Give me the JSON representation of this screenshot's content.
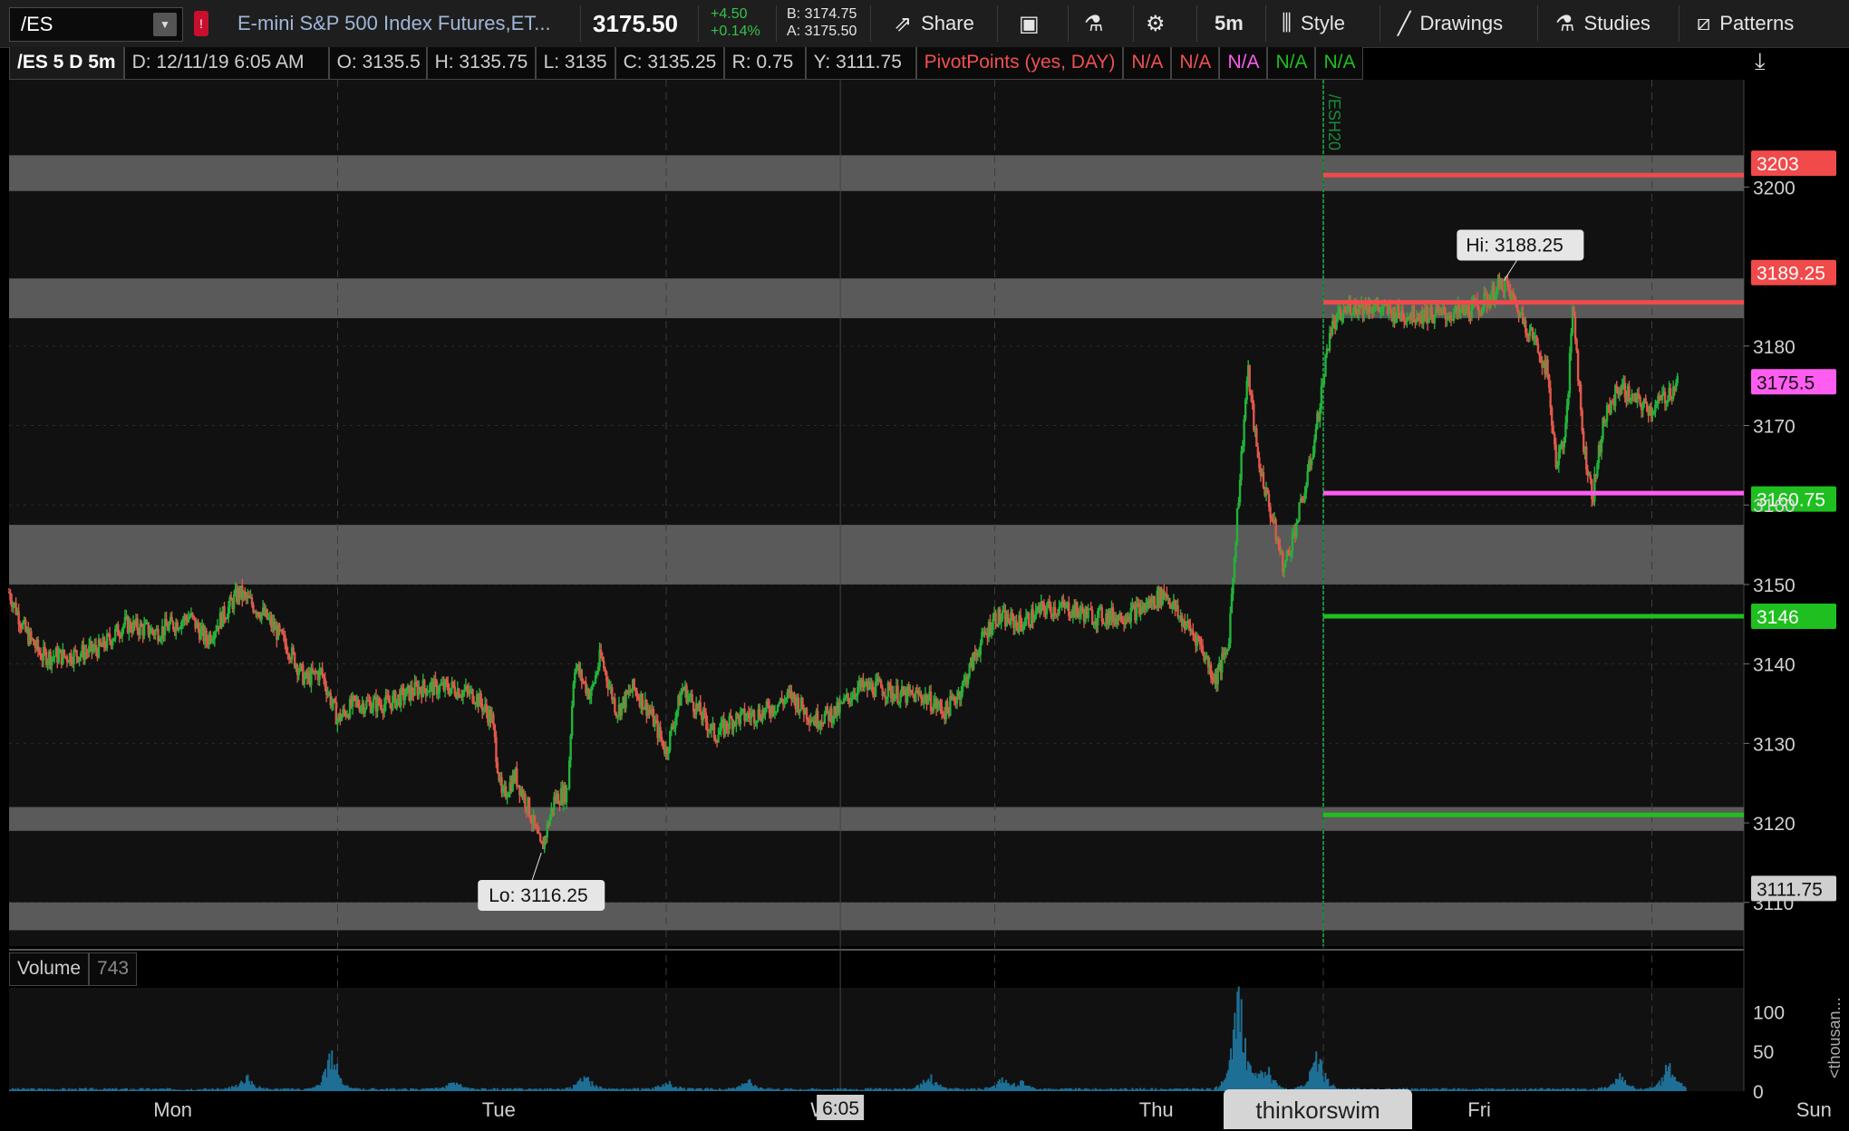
{
  "toolbar": {
    "symbol": "/ES",
    "description": "E-mini S&P 500 Index Futures,ET...",
    "last": "3175.50",
    "change": "+4.50",
    "change_pct": "+0.14%",
    "bid": "B: 3174.75",
    "ask": "A: 3175.50",
    "share_label": "Share",
    "timeframe": "5m",
    "style_label": "Style",
    "drawings_label": "Drawings",
    "studies_label": "Studies",
    "patterns_label": "Patterns"
  },
  "legend": {
    "symbol": "/ES 5 D 5m",
    "date": "D: 12/11/19 6:05 AM",
    "open": "O: 3135.5",
    "high": "H: 3135.75",
    "low": "L: 3135",
    "close": "C: 3135.25",
    "range": "R: 0.75",
    "y": "Y: 3111.75",
    "study": "PivotPoints (yes, DAY)",
    "na": [
      "N/A",
      "N/A",
      "N/A",
      "N/A",
      "N/A"
    ]
  },
  "volume_panel": {
    "label": "Volume",
    "value": "743",
    "axis_ticks": [
      "100",
      "50",
      "0"
    ],
    "unit": "<thousan..."
  },
  "watermark": "thinkorswim",
  "colors": {
    "up": "#22b33a",
    "down": "#e0584a",
    "r_line": "#f04a4a",
    "pp_line": "#ff5cf0",
    "s_line": "#1fbf1f",
    "zone": "#5a5a5a",
    "volume": "#1e6f96"
  },
  "chart_data": {
    "type": "line",
    "series_type": "candlestick",
    "ylim": [
      3104.5,
      3213.5
    ],
    "y_ticks": [
      3110,
      3120,
      3130,
      3140,
      3150,
      3160,
      3170,
      3180,
      3200
    ],
    "x_labels": [
      "Mon",
      "Tue",
      "Wed",
      "Thu",
      "Fri",
      "Sun"
    ],
    "x_label_positions": [
      0.5,
      1.5,
      2.5,
      3.5,
      4.5,
      5.5
    ],
    "x_range": [
      0,
      5.28
    ],
    "x_marker": {
      "label": "6:05",
      "x": 2.53
    },
    "session_marker": {
      "label": "/ESH20",
      "x": 4.0
    },
    "price_path": [
      [
        0.0,
        3149
      ],
      [
        0.05,
        3144
      ],
      [
        0.1,
        3141
      ],
      [
        0.18,
        3141
      ],
      [
        0.28,
        3142
      ],
      [
        0.35,
        3145
      ],
      [
        0.45,
        3144
      ],
      [
        0.55,
        3146
      ],
      [
        0.6,
        3143
      ],
      [
        0.7,
        3149
      ],
      [
        0.78,
        3146
      ],
      [
        0.85,
        3142
      ],
      [
        0.9,
        3138
      ],
      [
        0.95,
        3139
      ],
      [
        1.0,
        3133
      ],
      [
        1.05,
        3135
      ],
      [
        1.15,
        3135
      ],
      [
        1.25,
        3137
      ],
      [
        1.35,
        3137
      ],
      [
        1.42,
        3136
      ],
      [
        1.47,
        3133
      ],
      [
        1.5,
        3123
      ],
      [
        1.54,
        3126
      ],
      [
        1.58,
        3122
      ],
      [
        1.62,
        3116.5
      ],
      [
        1.66,
        3123
      ],
      [
        1.7,
        3124
      ],
      [
        1.72,
        3140
      ],
      [
        1.77,
        3136
      ],
      [
        1.8,
        3141
      ],
      [
        1.85,
        3134
      ],
      [
        1.9,
        3137
      ],
      [
        1.95,
        3134
      ],
      [
        2.0,
        3129
      ],
      [
        2.05,
        3137
      ],
      [
        2.1,
        3134
      ],
      [
        2.15,
        3131
      ],
      [
        2.2,
        3133
      ],
      [
        2.3,
        3134
      ],
      [
        2.38,
        3136
      ],
      [
        2.45,
        3133
      ],
      [
        2.52,
        3134
      ],
      [
        2.58,
        3137
      ],
      [
        2.65,
        3137
      ],
      [
        2.72,
        3136
      ],
      [
        2.78,
        3136
      ],
      [
        2.85,
        3134
      ],
      [
        2.9,
        3137
      ],
      [
        2.95,
        3142
      ],
      [
        3.0,
        3146
      ],
      [
        3.08,
        3145
      ],
      [
        3.15,
        3147
      ],
      [
        3.22,
        3147
      ],
      [
        3.3,
        3146
      ],
      [
        3.38,
        3146
      ],
      [
        3.45,
        3147
      ],
      [
        3.52,
        3149
      ],
      [
        3.56,
        3146
      ],
      [
        3.62,
        3143
      ],
      [
        3.67,
        3138
      ],
      [
        3.71,
        3142
      ],
      [
        3.74,
        3160
      ],
      [
        3.77,
        3177
      ],
      [
        3.8,
        3166
      ],
      [
        3.84,
        3159
      ],
      [
        3.88,
        3152
      ],
      [
        3.92,
        3158
      ],
      [
        3.95,
        3163
      ],
      [
        3.98,
        3170
      ],
      [
        4.02,
        3182
      ],
      [
        4.08,
        3185
      ],
      [
        4.15,
        3185
      ],
      [
        4.22,
        3184
      ],
      [
        4.3,
        3184
      ],
      [
        4.4,
        3184
      ],
      [
        4.48,
        3185
      ],
      [
        4.55,
        3188
      ],
      [
        4.6,
        3184
      ],
      [
        4.64,
        3181
      ],
      [
        4.68,
        3177
      ],
      [
        4.71,
        3165
      ],
      [
        4.74,
        3170
      ],
      [
        4.76,
        3186
      ],
      [
        4.79,
        3168
      ],
      [
        4.82,
        3161
      ],
      [
        4.85,
        3170
      ],
      [
        4.9,
        3175
      ],
      [
        4.95,
        3173
      ],
      [
        5.0,
        3172
      ],
      [
        5.05,
        3174
      ],
      [
        5.08,
        3175.5
      ]
    ],
    "high": {
      "label": "Hi: 3188.25",
      "x": 4.55,
      "value": 3188.25
    },
    "low": {
      "label": "Lo: 3116.25",
      "x": 1.62,
      "value": 3116.25
    },
    "zones": [
      [
        3199.5,
        3204
      ],
      [
        3183.5,
        3188.5
      ],
      [
        3150,
        3157.5
      ],
      [
        3119,
        3122
      ],
      [
        3106.5,
        3110
      ]
    ],
    "pivot_levels": [
      {
        "label": "3203",
        "value": 3201.5,
        "tag": 3203,
        "kind": "r"
      },
      {
        "label": "3189.25",
        "value": 3185.5,
        "tag": 3189.25,
        "kind": "r"
      },
      {
        "label": "3175.5",
        "value": 3161.5,
        "tag": 3175.5,
        "kind": "pp"
      },
      {
        "label": "3160.75",
        "value": 3146,
        "tag": 3160.75,
        "kind": "s"
      },
      {
        "label": "3146",
        "value": 3121,
        "tag": 3146,
        "kind": "s"
      }
    ],
    "last_tag": {
      "label": "3111.75",
      "value": 3111.75
    },
    "volume": {
      "ylim": [
        0,
        130
      ],
      "bursts": [
        [
          0.72,
          18
        ],
        [
          0.98,
          50
        ],
        [
          1.35,
          10
        ],
        [
          1.75,
          22
        ],
        [
          2.0,
          10
        ],
        [
          2.25,
          12
        ],
        [
          2.8,
          18
        ],
        [
          3.02,
          14
        ],
        [
          3.08,
          10
        ],
        [
          3.74,
          125
        ],
        [
          3.82,
          35
        ],
        [
          3.98,
          45
        ],
        [
          4.9,
          20
        ],
        [
          5.05,
          35
        ]
      ]
    }
  }
}
